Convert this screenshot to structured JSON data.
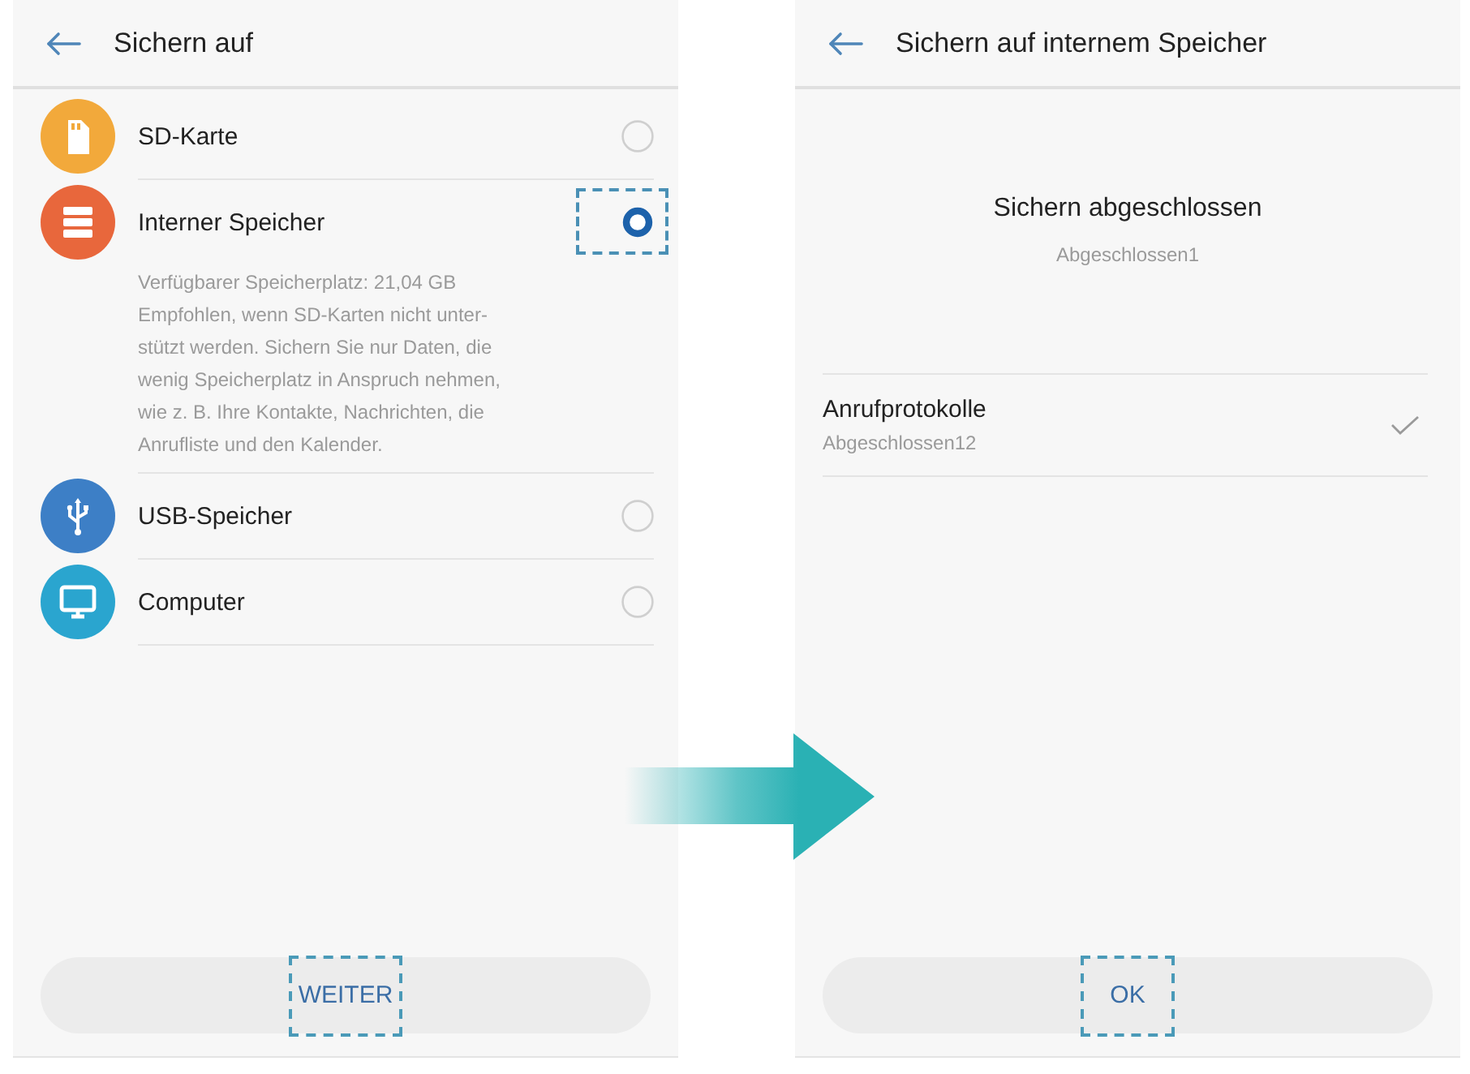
{
  "screens": [
    {
      "kind": "options",
      "title": "Sichern auf",
      "options": [
        {
          "label": "SD-Karte",
          "kind": "sd",
          "color": "#f2a93b",
          "selected": false,
          "highlighted": false
        },
        {
          "label": "Interner Speicher",
          "kind": "internal",
          "color": "#e8673c",
          "selected": true,
          "highlighted": true,
          "details": {
            "available": "Verfügbarer Speicherplatz: 21,04 GB",
            "lines": [
              "Empfohlen, wenn SD-Karten nicht unter-",
              "stützt werden. Sichern Sie nur Daten, die",
              "wenig Speicherplatz in Anspruch nehmen,",
              "wie z. B. Ihre Kontakte, Nachrichten, die",
              "Anrufliste und den Kalender."
            ]
          }
        },
        {
          "label": "USB-Speicher",
          "kind": "usb",
          "color": "#3d7fc6",
          "selected": false,
          "highlighted": false
        },
        {
          "label": "Computer",
          "kind": "computer",
          "color": "#2aa5cf",
          "selected": false,
          "highlighted": false
        }
      ],
      "button": {
        "label": "WEITER",
        "highlighted": true
      }
    },
    {
      "kind": "result",
      "title": "Sichern auf internem Speicher",
      "status": {
        "title": "Sichern abgeschlossen",
        "subtitle": "Abgeschlossen1"
      },
      "items": [
        {
          "label": "Anrufprotokolle",
          "subtitle": "Abgeschlossen12",
          "done": true
        }
      ],
      "button": {
        "label": "OK",
        "highlighted": true
      }
    }
  ]
}
